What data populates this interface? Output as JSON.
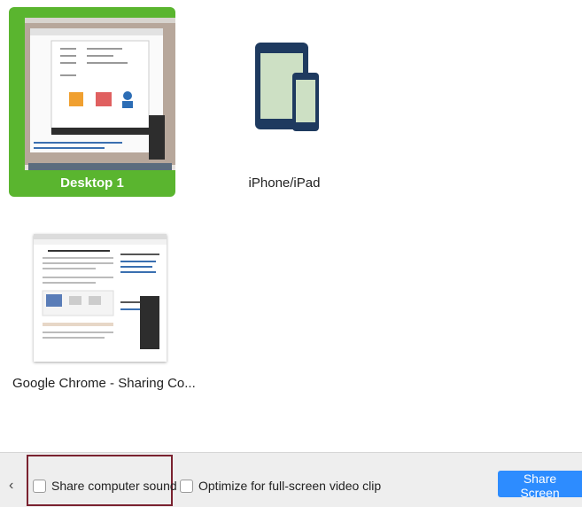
{
  "tiles": [
    {
      "label": "Desktop 1",
      "selected": true
    },
    {
      "label": "iPhone/iPad",
      "selected": false
    },
    {
      "label": "Google Chrome - Sharing Co...",
      "selected": false
    }
  ],
  "footer": {
    "share_sound_label": "Share computer sound",
    "optimize_label": "Optimize for full-screen video clip",
    "share_button_label": "Share Screen",
    "prev_icon": "chevron-left-icon"
  },
  "colors": {
    "selected_tile": "#5ab52f",
    "device_icon": "#1e3a5f",
    "device_screen": "#cde0c4",
    "share_button": "#2d8cff",
    "highlight_box": "#7a2230"
  }
}
